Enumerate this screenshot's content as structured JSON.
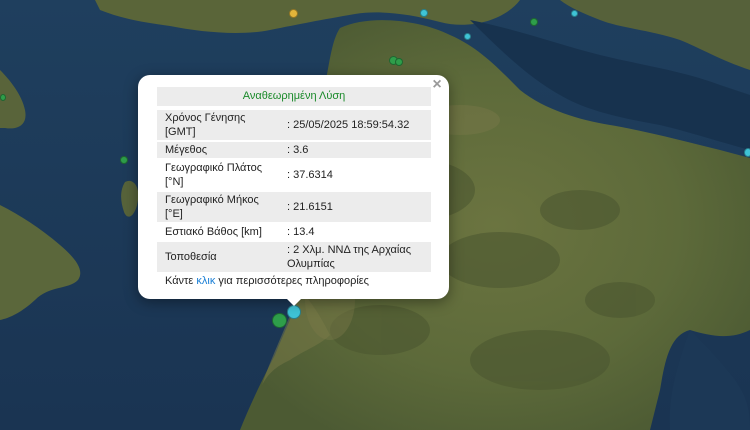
{
  "popup": {
    "close_symbol": "×",
    "title": "Αναθεωρημένη Λύση",
    "rows": [
      {
        "label": "Χρόνος Γένησης [GMT]",
        "value": ": 25/05/2025 18:59:54.32"
      },
      {
        "label": "Μέγεθος",
        "value": ": 3.6"
      },
      {
        "label": "Γεωγραφικό Πλάτος [°N]",
        "value": ": 37.6314"
      },
      {
        "label": "Γεωγραφικό Μήκος [°E]",
        "value": ": 21.6151"
      },
      {
        "label": "Εστιακό Βάθος [km]",
        "value": ": 13.4"
      },
      {
        "label": "Τοποθεσία",
        "value": ": 2 Χλμ. ΝΝΔ της Αρχαίας Ολυμπίας"
      }
    ],
    "footer_prefix": "Κάντε ",
    "footer_link": "κλικ",
    "footer_suffix": " για περισσότερες πληροφορίες"
  },
  "colors": {
    "title_green": "#1a8a2a",
    "link_blue": "#1a7fd6",
    "sea": "#1c3a58",
    "land": "#5f6a3c",
    "marker_green": "#2e9e4a",
    "marker_cyan": "#3fc4d6",
    "marker_yellow": "#e2b53a"
  },
  "markers": [
    {
      "name": "marker-yellow",
      "color": "#e2b53a"
    },
    {
      "name": "marker-cyan",
      "color": "#3fc4d6"
    },
    {
      "name": "marker-green",
      "color": "#2e9e4a"
    },
    {
      "name": "marker-selected",
      "color": "#3fc4d6"
    }
  ]
}
